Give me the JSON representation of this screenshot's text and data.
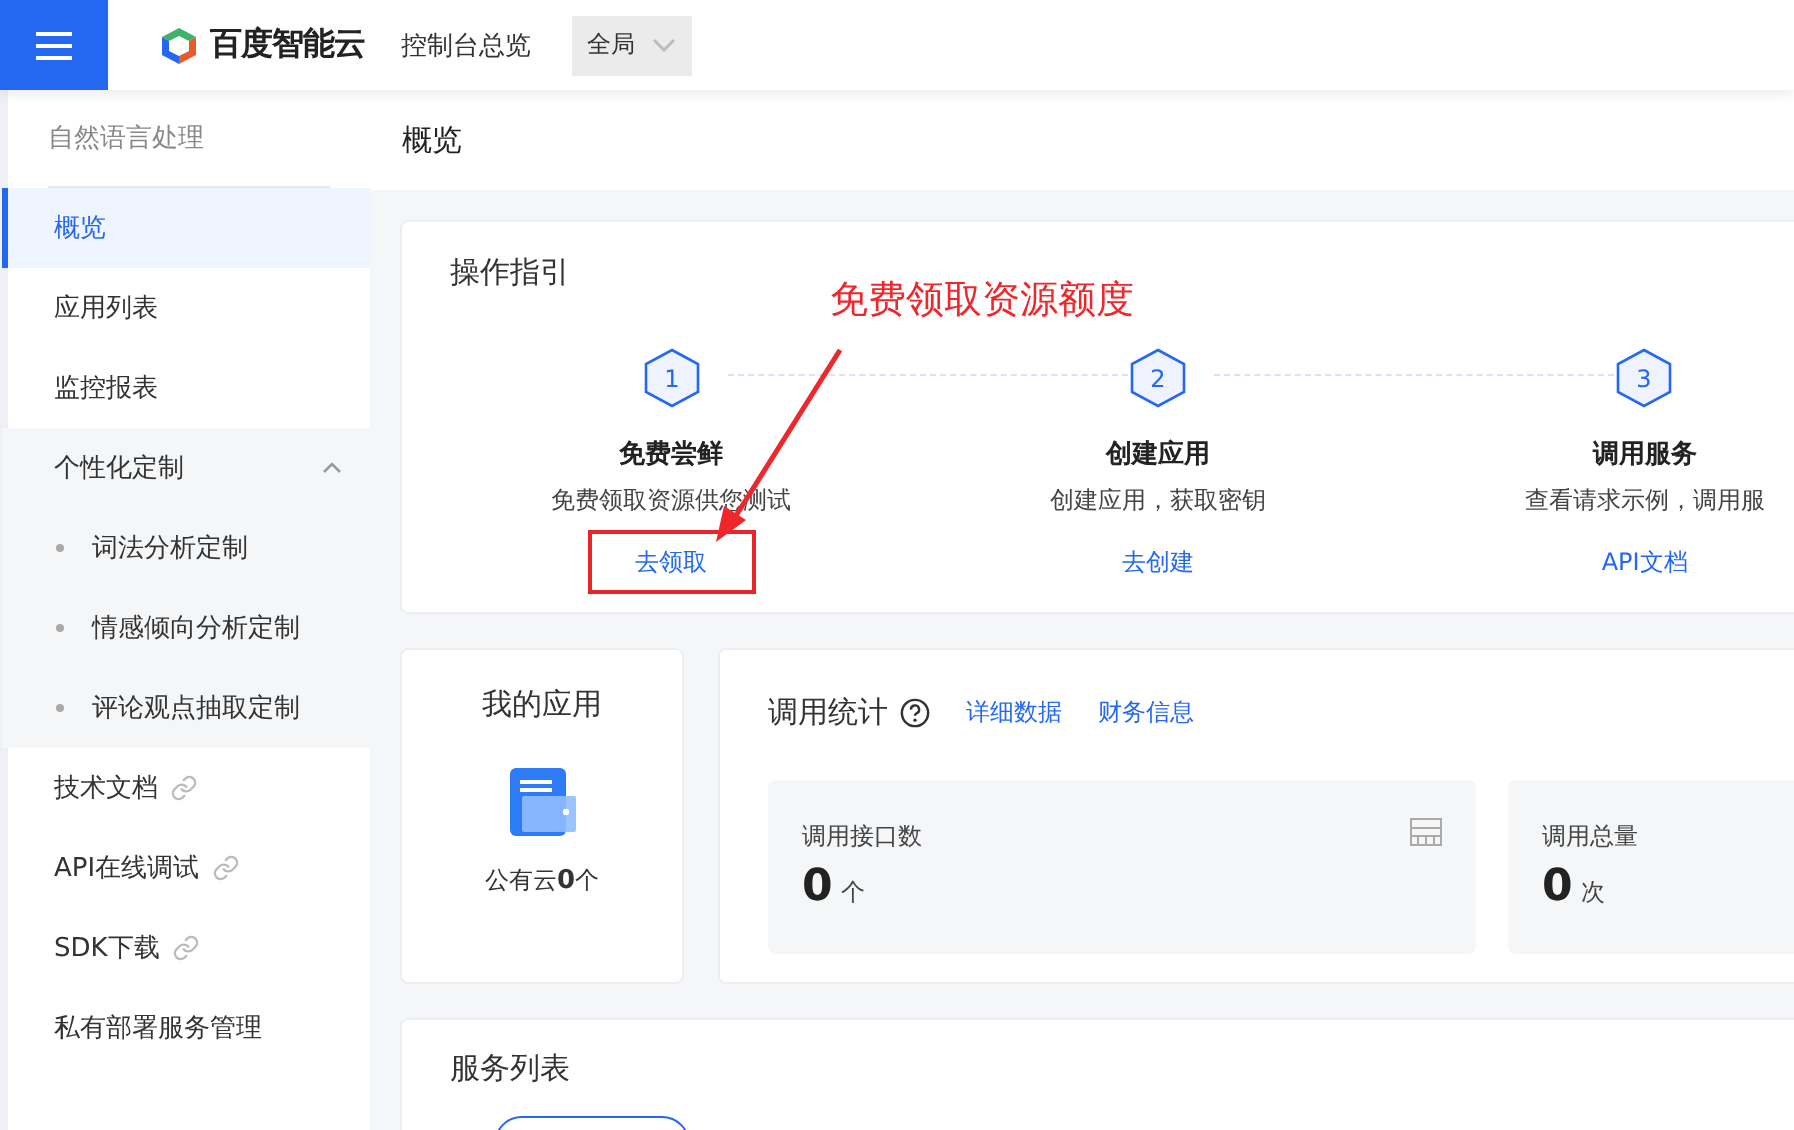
{
  "topbar": {
    "brand": "百度智能云",
    "nav": "控制台总览",
    "region": "全局"
  },
  "sidebar": {
    "title": "自然语言处理",
    "items": [
      {
        "label": "概览",
        "kind": "item",
        "selected": true
      },
      {
        "label": "应用列表",
        "kind": "item",
        "selected": false
      },
      {
        "label": "监控报表",
        "kind": "item",
        "selected": false
      },
      {
        "label": "个性化定制",
        "kind": "group",
        "selected": false,
        "expanded": true,
        "children": [
          {
            "label": "词法分析定制",
            "selected": false
          },
          {
            "label": "情感倾向分析定制",
            "selected": false
          },
          {
            "label": "评论观点抽取定制",
            "selected": false
          }
        ]
      },
      {
        "label": "技术文档",
        "kind": "link",
        "selected": false
      },
      {
        "label": "API在线调试",
        "kind": "link",
        "selected": false
      },
      {
        "label": "SDK下载",
        "kind": "link",
        "selected": false
      },
      {
        "label": "私有部署服务管理",
        "kind": "item",
        "selected": false
      }
    ]
  },
  "page_title": "概览",
  "guide": {
    "title": "操作指引",
    "steps": [
      {
        "number": "1",
        "title": "免费尝鲜",
        "description": "免费领取资源供您测试",
        "action": "去领取",
        "highlighted": true
      },
      {
        "number": "2",
        "title": "创建应用",
        "description": "创建应用，获取密钥",
        "action": "去创建",
        "highlighted": false
      },
      {
        "number": "3",
        "title": "调用服务",
        "description": "查看请求示例，调用服",
        "action": "API文档",
        "highlighted": false
      }
    ]
  },
  "annotation": {
    "text": "免费领取资源额度"
  },
  "my_apps": {
    "title": "我的应用",
    "summary": "公有云**0**个"
  },
  "stats": {
    "title": "调用统计",
    "links": [
      "详细数据",
      "财务信息"
    ],
    "cards": [
      {
        "label": "调用接口数",
        "value": "0",
        "unit": "个"
      },
      {
        "label": "调用总量",
        "value": "0",
        "unit": "次"
      }
    ]
  },
  "services": {
    "title": "服务列表"
  }
}
